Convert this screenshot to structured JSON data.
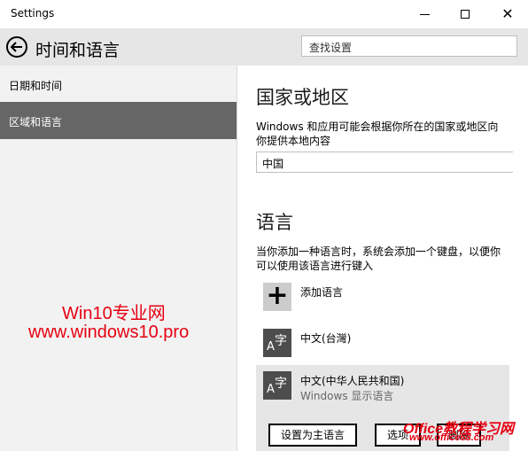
{
  "window": {
    "title": "Settings",
    "minimize_glyph": "",
    "close_glyph": "✕"
  },
  "header": {
    "title": "时间和语言",
    "search_placeholder": "查找设置"
  },
  "sidebar": {
    "items": [
      {
        "label": "日期和时间"
      },
      {
        "label": "区域和语言"
      }
    ],
    "selected": "区域和语言"
  },
  "watermark": {
    "line1": "Win10专业网",
    "line2": "www.windows10.pro",
    "brand": "Office教程学习网",
    "url": "www.office68.com"
  },
  "main": {
    "country_heading": "国家或地区",
    "country_desc": "Windows 和应用可能会根据你所在的国家或地区向你提供本地内容",
    "country_value": "中国",
    "language_heading": "语言",
    "language_desc": "当你添加一种语言时，系统会添加一个键盘，以便你可以使用该语言进行键入",
    "add_language": {
      "icon": "+",
      "label": "添加语言"
    },
    "tile_glyph_a": "A",
    "tile_glyph_zi": "字",
    "languages": [
      {
        "name": "中文(台灣)"
      },
      {
        "name": "中文(中华人民共和国)",
        "sub": "Windows 显示语言"
      }
    ],
    "buttons": {
      "set_primary": "设置为主语言",
      "options": "选项",
      "remove": "删除"
    }
  },
  "colors": {
    "header_bg": "#e6e6e6",
    "sidebar_bg": "#f2f2f2",
    "selected_bg": "#666666",
    "tile_bg": "#4d4d4d",
    "watermark": "#e60012"
  }
}
